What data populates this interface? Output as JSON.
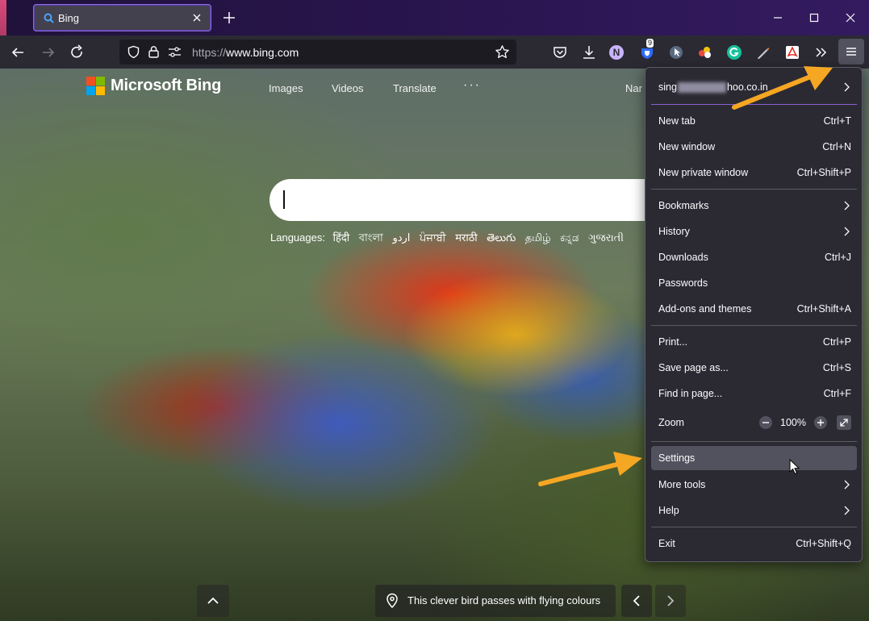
{
  "browser": {
    "tab": {
      "title": "Bing"
    },
    "url": {
      "scheme": "https://",
      "host": "www.bing.com"
    },
    "extensions": {
      "n_label": "N",
      "badge_count": "9"
    }
  },
  "bing": {
    "brand": "Microsoft Bing",
    "nav": {
      "images": "Images",
      "videos": "Videos",
      "translate": "Translate",
      "more": "···",
      "user_partial": "Nar"
    },
    "languages": {
      "label": "Languages:",
      "items": [
        "हिंदी",
        "বাংলা",
        "اردو",
        "ਪੰਜਾਬੀ",
        "मराठी",
        "తెలుగు",
        "தமிழ்",
        "ಕನ್ನಡ",
        "ગુજરાતી"
      ]
    },
    "caption": "This clever bird passes with flying colours"
  },
  "menu": {
    "account": {
      "prefix": "sing",
      "suffix": "hoo.co.in"
    },
    "items": {
      "new_tab": {
        "label": "New tab",
        "shortcut": "Ctrl+T"
      },
      "new_window": {
        "label": "New window",
        "shortcut": "Ctrl+N"
      },
      "new_private_window": {
        "label": "New private window",
        "shortcut": "Ctrl+Shift+P"
      },
      "bookmarks": {
        "label": "Bookmarks"
      },
      "history": {
        "label": "History"
      },
      "downloads": {
        "label": "Downloads",
        "shortcut": "Ctrl+J"
      },
      "passwords": {
        "label": "Passwords"
      },
      "addons": {
        "label": "Add-ons and themes",
        "shortcut": "Ctrl+Shift+A"
      },
      "print": {
        "label": "Print...",
        "shortcut": "Ctrl+P"
      },
      "save_page": {
        "label": "Save page as...",
        "shortcut": "Ctrl+S"
      },
      "find": {
        "label": "Find in page...",
        "shortcut": "Ctrl+F"
      },
      "zoom": {
        "label": "Zoom",
        "value": "100%"
      },
      "settings": {
        "label": "Settings"
      },
      "more_tools": {
        "label": "More tools"
      },
      "help": {
        "label": "Help"
      },
      "exit": {
        "label": "Exit",
        "shortcut": "Ctrl+Shift+Q"
      }
    }
  },
  "colors": {
    "annotation_arrow": "#f5a623",
    "accent": "#8b5fd3",
    "menu_bg": "#2b2a33"
  }
}
